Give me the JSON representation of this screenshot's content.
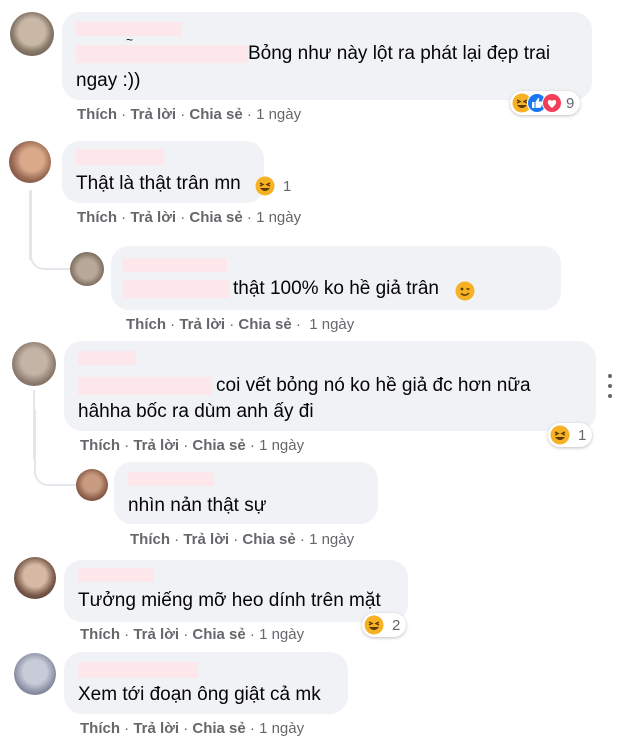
{
  "comments": [
    {
      "text_line1": "Bỏng như này lột ra phát lại đẹp trai",
      "text_line2": "ngay :))",
      "like": "Thích",
      "reply": "Trả lời",
      "share": "Chia sẻ",
      "time": "1 ngày",
      "reaction_count": "9"
    },
    {
      "text_line1": "Thật là thật trân mn",
      "like": "Thích",
      "reply": "Trả lời",
      "share": "Chia sẻ",
      "time": "1 ngày",
      "reaction_count": "1"
    },
    {
      "text_line1": "thật 100% ko hề giả trân",
      "like": "Thích",
      "reply": "Trả lời",
      "share": "Chia sẻ",
      "time": "1 ngày"
    },
    {
      "text_line1": "coi vết bỏng nó ko hề giả đc hơn nữa",
      "text_line2": "hâhha bốc ra dùm anh ấy đi",
      "like": "Thích",
      "reply": "Trả lời",
      "share": "Chia sẻ",
      "time": "1 ngày",
      "reaction_count": "1"
    },
    {
      "text_line1": "nhìn nản thật sự",
      "like": "Thích",
      "reply": "Trả lời",
      "share": "Chia sẻ",
      "time": "1 ngày"
    },
    {
      "text_line1": "Tưởng miếng mỡ heo dính trên mặt",
      "like": "Thích",
      "reply": "Trả lời",
      "share": "Chia sẻ",
      "time": "1 ngày",
      "reaction_count": "2"
    },
    {
      "text_line1": "Xem tới đoạn ông giật cả mk",
      "like": "Thích",
      "reply": "Trả lời",
      "share": "Chia sẻ",
      "time": "1 ngày"
    }
  ],
  "icons": {
    "haha": "haha-reaction-icon",
    "like": "like-reaction-icon",
    "love": "love-reaction-icon",
    "wink": "wink-emoji-icon",
    "more": "more-options-icon"
  },
  "colors": {
    "bubble": "#f0f2f5",
    "meta": "#65676b",
    "haha": "#f7b125",
    "like": "#1877f2",
    "love": "#f33e58",
    "redaction": "#fde7ea"
  }
}
